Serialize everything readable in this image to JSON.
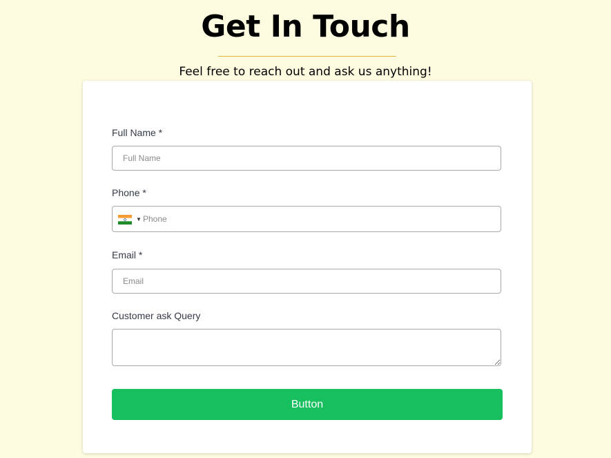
{
  "header": {
    "title": "Get In Touch",
    "subtitle": "Feel free to reach out and ask us anything!"
  },
  "form": {
    "full_name": {
      "label": "Full Name *",
      "placeholder": "Full Name",
      "value": ""
    },
    "phone": {
      "label": "Phone *",
      "placeholder": "Phone",
      "value": "",
      "country_flag": "india-flag-icon"
    },
    "email": {
      "label": "Email *",
      "placeholder": "Email",
      "value": ""
    },
    "query": {
      "label": "Customer ask Query",
      "value": ""
    },
    "submit_label": "Button"
  },
  "colors": {
    "page_background": "#fefce0",
    "accent_divider": "#e0b23a",
    "button": "#17bf5e",
    "card": "#ffffff"
  }
}
